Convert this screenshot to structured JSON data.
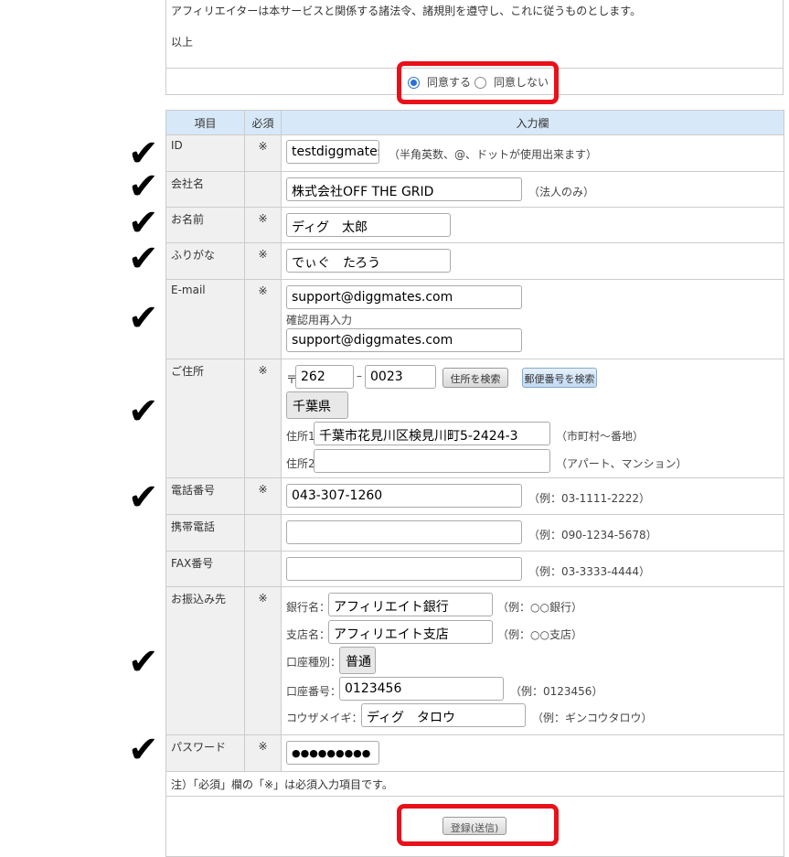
{
  "terms": {
    "text": "アフィリエイターは本サービスと関係する諸法令、諸規則を遵守し、これに従うものとします。",
    "closing": "以上"
  },
  "agreement": {
    "agree_label": "同意する",
    "disagree_label": "同意しない",
    "selected": "agree"
  },
  "table_headers": {
    "item": "項目",
    "required": "必須",
    "input": "入力欄"
  },
  "required_mark": "※",
  "fields": {
    "id": {
      "label": "ID",
      "value": "testdiggmates",
      "note": "（半角英数、@、ドットが使用出来ます）"
    },
    "company": {
      "label": "会社名",
      "value": "株式会社OFF THE GRID",
      "note": "（法人のみ）"
    },
    "name": {
      "label": "お名前",
      "value": "ディグ　太郎"
    },
    "furigana": {
      "label": "ふりがな",
      "value": "でぃぐ　たろう"
    },
    "email": {
      "label": "E-mail",
      "value": "support@diggmates.com",
      "confirm_label": "確認用再入力",
      "confirm_value": "support@diggmates.com"
    },
    "address": {
      "label": "ご住所",
      "postal_mark": "〒",
      "zip1": "262",
      "dash": "–",
      "zip2": "0023",
      "search_address_button": "住所を検索",
      "search_zip_button": "郵便番号を検索",
      "prefecture": "千葉県",
      "addr1_label": "住所1",
      "addr1_value": "千葉市花見川区検見川町5-2424-3",
      "addr1_note": "（市町村～番地）",
      "addr2_label": "住所2",
      "addr2_value": "",
      "addr2_note": "（アパート、マンション）"
    },
    "phone": {
      "label": "電話番号",
      "value": "043-307-1260",
      "note": "（例：03-1111-2222）"
    },
    "mobile": {
      "label": "携帯電話",
      "value": "",
      "note": "（例：090-1234-5678）"
    },
    "fax": {
      "label": "FAX番号",
      "value": "",
      "note": "（例：03-3333-4444）"
    },
    "bank": {
      "label": "お振込み先",
      "bank_name_label": "銀行名：",
      "bank_name_value": "アフィリエイト銀行",
      "bank_name_note": "（例：○○銀行）",
      "branch_label": "支店名：",
      "branch_value": "アフィリエイト支店",
      "branch_note": "（例：○○支店）",
      "type_label": "口座種別：",
      "type_value": "普通",
      "number_label": "口座番号：",
      "number_value": "0123456",
      "number_note": "（例：0123456）",
      "holder_label": "コウザメイギ：",
      "holder_value": "ディグ　タロウ",
      "holder_note": "（例：ギンコウタロウ）"
    },
    "password": {
      "label": "パスワード",
      "value": "●●●●●●●●●"
    }
  },
  "footnote": "注）「必須」欄の「※」は必須入力項目です。",
  "submit_label": "登録(送信)",
  "checkmark": "✔"
}
